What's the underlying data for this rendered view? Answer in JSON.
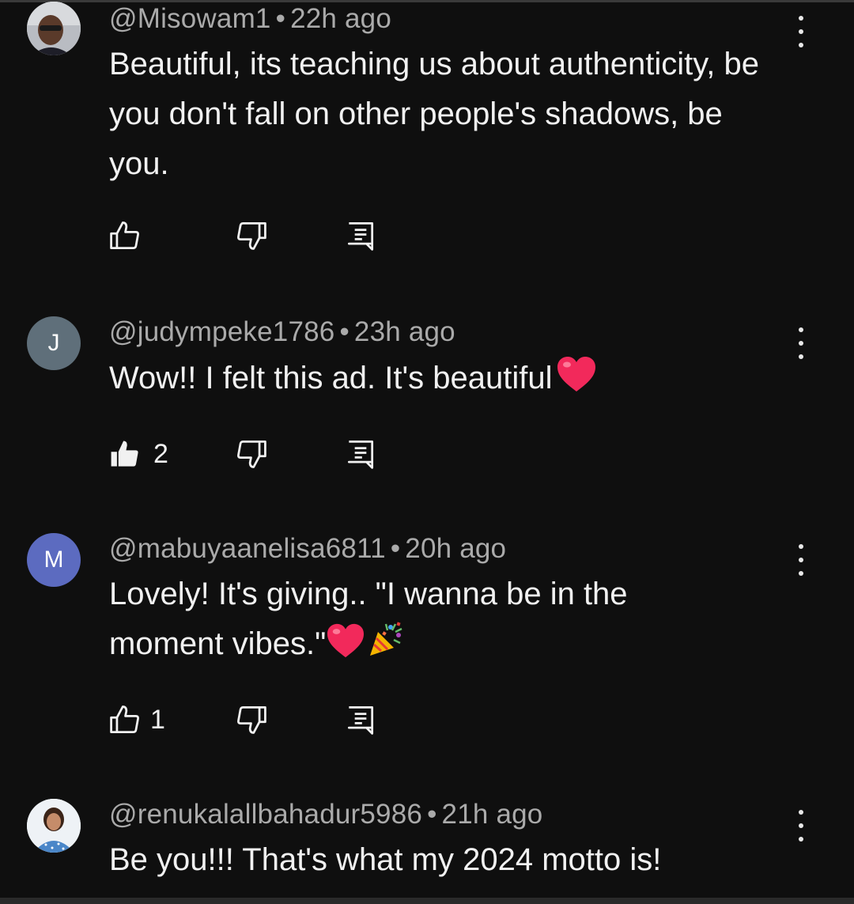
{
  "comments": [
    {
      "author": "@Misowam1",
      "time": "22h ago",
      "avatar": {
        "type": "photo",
        "letter": ""
      },
      "text": "Beautiful, its teaching us about authenticity, be you don't fall on other people's shadows, be you.",
      "likes": "",
      "liked": false
    },
    {
      "author": "@judympeke1786",
      "time": "23h ago",
      "avatar": {
        "type": "letter",
        "letter": "J",
        "color": "#5f6f7a"
      },
      "text": "Wow!! I felt this ad. It's beautiful",
      "emoji": "heart",
      "likes": "2",
      "liked": true
    },
    {
      "author": "@mabuyaanelisa6811",
      "time": "20h ago",
      "avatar": {
        "type": "letter",
        "letter": "M",
        "color": "#5c6bc0"
      },
      "text": "Lovely! It's giving.. \"I wanna be in the moment vibes.\"",
      "emoji": "heart-party",
      "likes": "1",
      "liked": false
    },
    {
      "author": "@renukalallbahadur5986",
      "time": "21h ago",
      "avatar": {
        "type": "photo",
        "letter": ""
      },
      "text": "Be you!!! That's what my 2024 motto is!",
      "likes": "",
      "liked": false
    }
  ],
  "separator": "•",
  "icons": {
    "like": "thumb-up-icon",
    "dislike": "thumb-down-icon",
    "reply": "comment-reply-icon",
    "menu": "more-vert-icon"
  },
  "colors": {
    "background": "#0f0f0f",
    "text": "#f1f1f1",
    "meta": "#aaaaaa"
  }
}
